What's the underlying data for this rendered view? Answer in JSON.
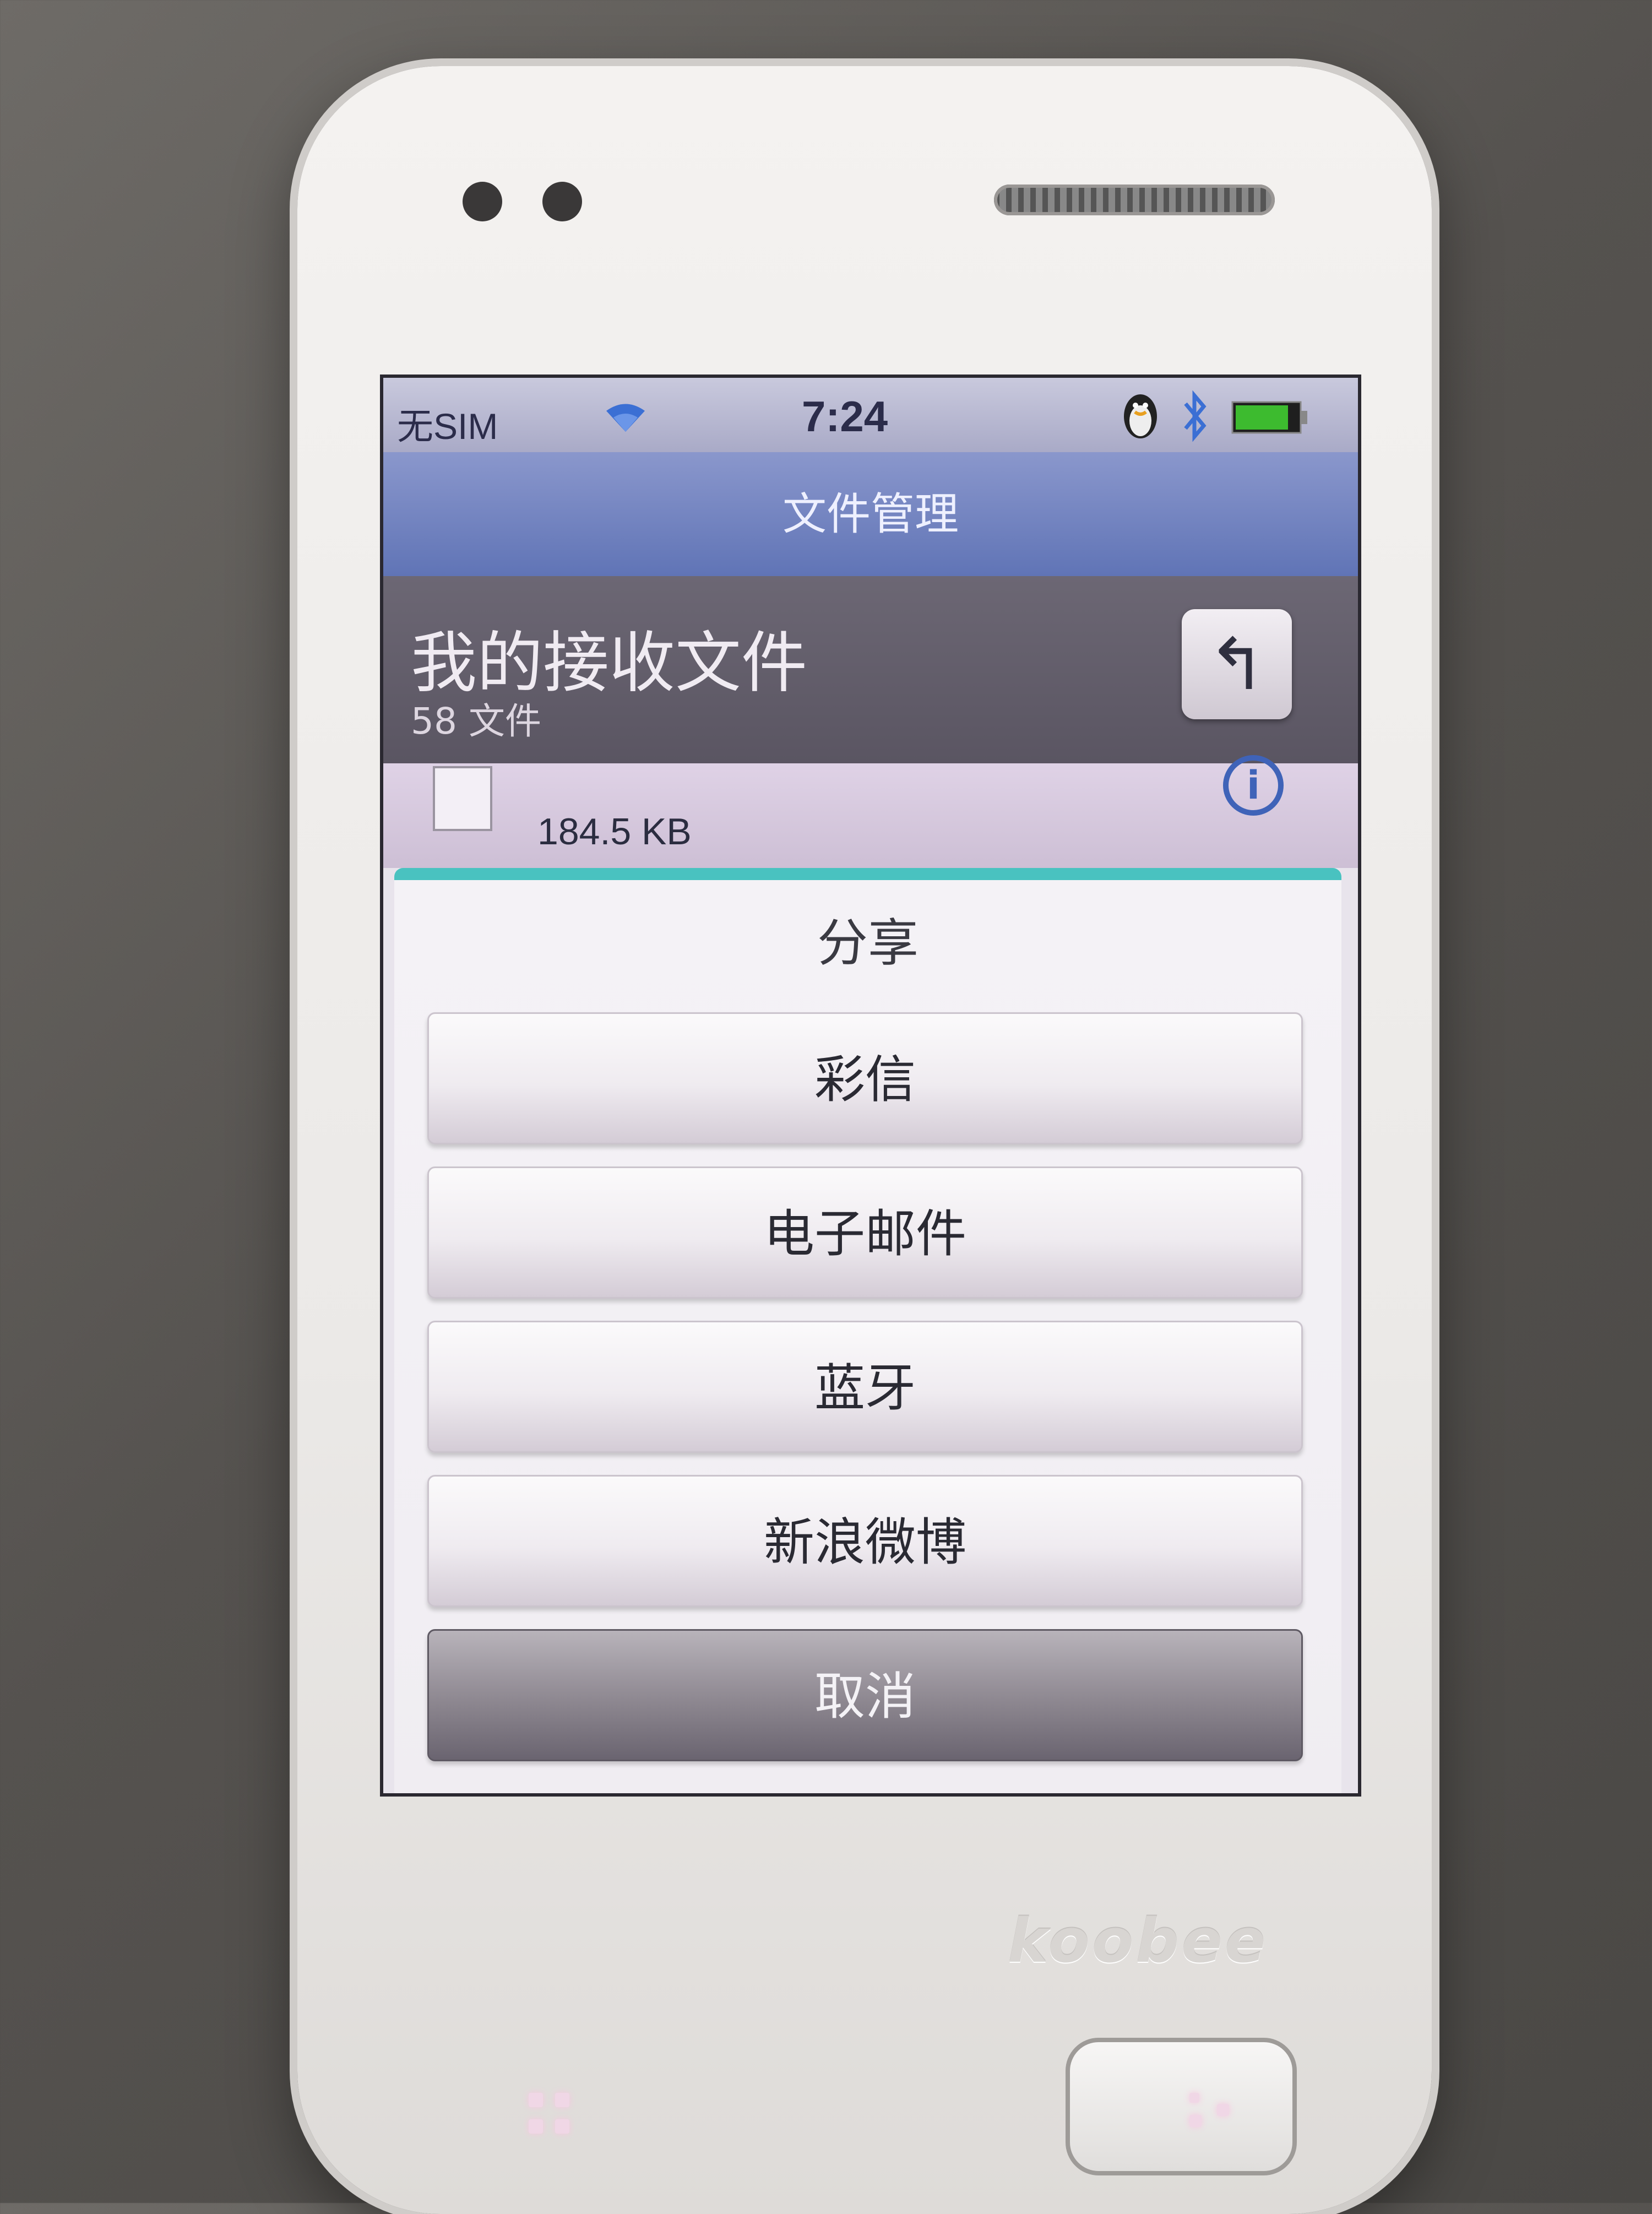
{
  "device": {
    "brand_logo": "koobee"
  },
  "status_bar": {
    "carrier": "无SIM",
    "time": "7:24",
    "icons": [
      "wifi-icon",
      "qq-penguin-icon",
      "bluetooth-icon",
      "battery-icon"
    ]
  },
  "app": {
    "title": "文件管理"
  },
  "path": {
    "folder_name": "我的接收文件",
    "file_count": "58 文件"
  },
  "file_item": {
    "size": "184.5 KB"
  },
  "share_dialog": {
    "title": "分享",
    "options": [
      "彩信",
      "电子邮件",
      "蓝牙",
      "新浪微博"
    ],
    "cancel_label": "取消"
  },
  "colors": {
    "accent_bar": "#49c2c0",
    "title_bar": "#6074b6",
    "info_icon": "#3f63b8"
  }
}
